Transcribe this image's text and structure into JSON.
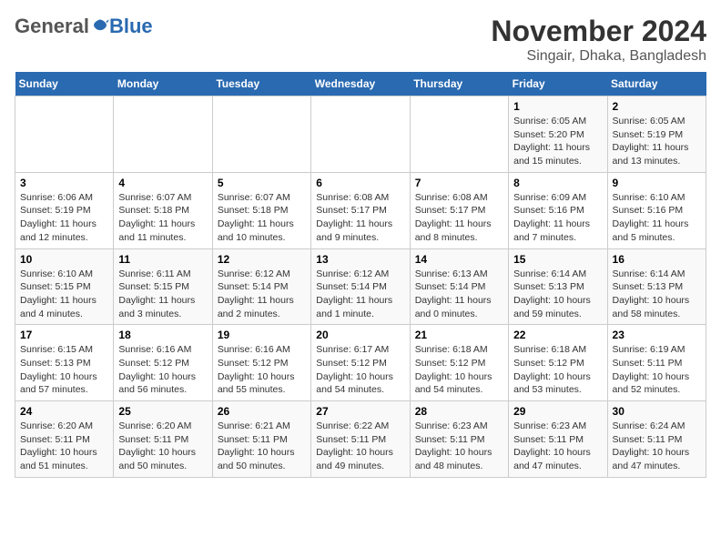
{
  "header": {
    "logo_general": "General",
    "logo_blue": "Blue",
    "month_title": "November 2024",
    "location": "Singair, Dhaka, Bangladesh"
  },
  "days_of_week": [
    "Sunday",
    "Monday",
    "Tuesday",
    "Wednesday",
    "Thursday",
    "Friday",
    "Saturday"
  ],
  "weeks": [
    [
      {
        "day": "",
        "info": ""
      },
      {
        "day": "",
        "info": ""
      },
      {
        "day": "",
        "info": ""
      },
      {
        "day": "",
        "info": ""
      },
      {
        "day": "",
        "info": ""
      },
      {
        "day": "1",
        "info": "Sunrise: 6:05 AM\nSunset: 5:20 PM\nDaylight: 11 hours and 15 minutes."
      },
      {
        "day": "2",
        "info": "Sunrise: 6:05 AM\nSunset: 5:19 PM\nDaylight: 11 hours and 13 minutes."
      }
    ],
    [
      {
        "day": "3",
        "info": "Sunrise: 6:06 AM\nSunset: 5:19 PM\nDaylight: 11 hours and 12 minutes."
      },
      {
        "day": "4",
        "info": "Sunrise: 6:07 AM\nSunset: 5:18 PM\nDaylight: 11 hours and 11 minutes."
      },
      {
        "day": "5",
        "info": "Sunrise: 6:07 AM\nSunset: 5:18 PM\nDaylight: 11 hours and 10 minutes."
      },
      {
        "day": "6",
        "info": "Sunrise: 6:08 AM\nSunset: 5:17 PM\nDaylight: 11 hours and 9 minutes."
      },
      {
        "day": "7",
        "info": "Sunrise: 6:08 AM\nSunset: 5:17 PM\nDaylight: 11 hours and 8 minutes."
      },
      {
        "day": "8",
        "info": "Sunrise: 6:09 AM\nSunset: 5:16 PM\nDaylight: 11 hours and 7 minutes."
      },
      {
        "day": "9",
        "info": "Sunrise: 6:10 AM\nSunset: 5:16 PM\nDaylight: 11 hours and 5 minutes."
      }
    ],
    [
      {
        "day": "10",
        "info": "Sunrise: 6:10 AM\nSunset: 5:15 PM\nDaylight: 11 hours and 4 minutes."
      },
      {
        "day": "11",
        "info": "Sunrise: 6:11 AM\nSunset: 5:15 PM\nDaylight: 11 hours and 3 minutes."
      },
      {
        "day": "12",
        "info": "Sunrise: 6:12 AM\nSunset: 5:14 PM\nDaylight: 11 hours and 2 minutes."
      },
      {
        "day": "13",
        "info": "Sunrise: 6:12 AM\nSunset: 5:14 PM\nDaylight: 11 hours and 1 minute."
      },
      {
        "day": "14",
        "info": "Sunrise: 6:13 AM\nSunset: 5:14 PM\nDaylight: 11 hours and 0 minutes."
      },
      {
        "day": "15",
        "info": "Sunrise: 6:14 AM\nSunset: 5:13 PM\nDaylight: 10 hours and 59 minutes."
      },
      {
        "day": "16",
        "info": "Sunrise: 6:14 AM\nSunset: 5:13 PM\nDaylight: 10 hours and 58 minutes."
      }
    ],
    [
      {
        "day": "17",
        "info": "Sunrise: 6:15 AM\nSunset: 5:13 PM\nDaylight: 10 hours and 57 minutes."
      },
      {
        "day": "18",
        "info": "Sunrise: 6:16 AM\nSunset: 5:12 PM\nDaylight: 10 hours and 56 minutes."
      },
      {
        "day": "19",
        "info": "Sunrise: 6:16 AM\nSunset: 5:12 PM\nDaylight: 10 hours and 55 minutes."
      },
      {
        "day": "20",
        "info": "Sunrise: 6:17 AM\nSunset: 5:12 PM\nDaylight: 10 hours and 54 minutes."
      },
      {
        "day": "21",
        "info": "Sunrise: 6:18 AM\nSunset: 5:12 PM\nDaylight: 10 hours and 54 minutes."
      },
      {
        "day": "22",
        "info": "Sunrise: 6:18 AM\nSunset: 5:12 PM\nDaylight: 10 hours and 53 minutes."
      },
      {
        "day": "23",
        "info": "Sunrise: 6:19 AM\nSunset: 5:11 PM\nDaylight: 10 hours and 52 minutes."
      }
    ],
    [
      {
        "day": "24",
        "info": "Sunrise: 6:20 AM\nSunset: 5:11 PM\nDaylight: 10 hours and 51 minutes."
      },
      {
        "day": "25",
        "info": "Sunrise: 6:20 AM\nSunset: 5:11 PM\nDaylight: 10 hours and 50 minutes."
      },
      {
        "day": "26",
        "info": "Sunrise: 6:21 AM\nSunset: 5:11 PM\nDaylight: 10 hours and 50 minutes."
      },
      {
        "day": "27",
        "info": "Sunrise: 6:22 AM\nSunset: 5:11 PM\nDaylight: 10 hours and 49 minutes."
      },
      {
        "day": "28",
        "info": "Sunrise: 6:23 AM\nSunset: 5:11 PM\nDaylight: 10 hours and 48 minutes."
      },
      {
        "day": "29",
        "info": "Sunrise: 6:23 AM\nSunset: 5:11 PM\nDaylight: 10 hours and 47 minutes."
      },
      {
        "day": "30",
        "info": "Sunrise: 6:24 AM\nSunset: 5:11 PM\nDaylight: 10 hours and 47 minutes."
      }
    ]
  ]
}
